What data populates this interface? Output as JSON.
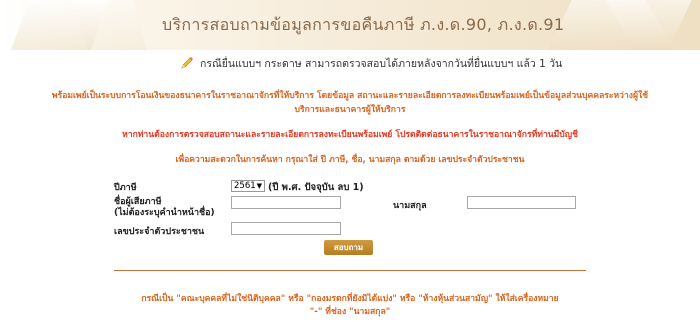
{
  "banner": {
    "title": "บริการสอบถามข้อมูลการขอคืนภาษี ภ.ง.ด.90, ภ.ง.ด.91"
  },
  "notice": {
    "icon": "pencil-icon",
    "text": "กรณียื่นแบบฯ กระดาษ สามารถตรวจสอบได้ภายหลังจากวันที่ยื่นแบบฯ แล้ว 1 วัน"
  },
  "info": {
    "line1": "พร้อมเพย์เป็นระบบการโอนเงินของธนาคารในราชอาณาจักรที่ให้บริการ โดยข้อมูล สถานะและรายละเอียดการลงทะเบียนพร้อมเพย์เป็นข้อมูลส่วนบุคคลระหว่างผู้ใช้",
    "line2": "บริการและธนาคารผู้ให้บริการ",
    "warning": "หากท่านต้องการตรวจสอบสถานะและรายละเอียดการลงทะเบียนพร้อมเพย์ โปรดติดต่อธนาคารในราชอาณาจักรที่ท่านมีบัญชี",
    "instruction": "เพื่อความสะดวกในการค้นหา กรุณาใส่ ปี ภาษี, ชื่อ, นามสกุล ตามด้วย เลขประจำตัวประชาชน"
  },
  "form": {
    "year_label": "ปีภาษี",
    "year_value": "2561",
    "year_hint": "(ปี พ.ศ. ปัจจุบัน ลบ 1)",
    "name_label_1": "ชื่อผู้เสียภาษี",
    "name_label_2": "(ไม่ต้องระบุคำนำหน้าชื่อ)",
    "name_value": "",
    "surname_label": "นามสกุล",
    "surname_value": "",
    "id_label": "เลขประจำตัวประชาชน",
    "id_value": "",
    "search_button": "สอบถาม"
  },
  "footer": {
    "line1": "กรณีเป็น \"คณะบุคคลที่ไม่ใช่นิติบุคคล\" หรือ \"กองมรดกที่ยังมิได้แบ่ง\" หรือ \"ห้างหุ้นส่วนสามัญ\" ให้ใส่เครื่องหมาย",
    "line2": "\"-\" ที่ช่อง \"นามสกุล\""
  },
  "colors": {
    "accent": "#d6651f",
    "warning": "#e03620",
    "button": "#b67e24",
    "banner_text": "#8a6a4a"
  }
}
